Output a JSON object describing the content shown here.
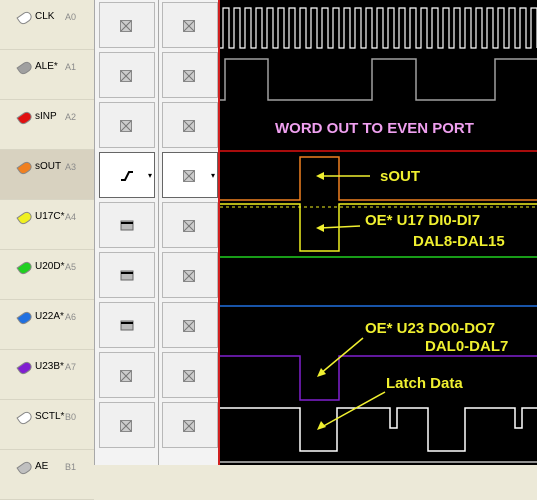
{
  "channels": [
    {
      "name": "CLK",
      "ch": "A0",
      "color": "#ffffff"
    },
    {
      "name": "ALE*",
      "ch": "A1",
      "color": "#a0a0a0"
    },
    {
      "name": "sINP",
      "ch": "A2",
      "color": "#e01010"
    },
    {
      "name": "sOUT",
      "ch": "A3",
      "color": "#f08020"
    },
    {
      "name": "U17C*",
      "ch": "A4",
      "color": "#f0f020"
    },
    {
      "name": "U20D*",
      "ch": "A5",
      "color": "#20d020"
    },
    {
      "name": "U22A*",
      "ch": "A6",
      "color": "#2070e0"
    },
    {
      "name": "U23B*",
      "ch": "A7",
      "color": "#8020d0"
    },
    {
      "name": "SCTL*",
      "ch": "B0",
      "color": "#ffffff"
    },
    {
      "name": "AE",
      "ch": "B1",
      "color": "#c0c0c0"
    }
  ],
  "trigger_col1": [
    "dontcare",
    "dontcare",
    "dontcare",
    "rising",
    "low",
    "low",
    "low",
    "dontcare",
    "dontcare"
  ],
  "trigger_col2": [
    "dontcare",
    "dontcare",
    "dontcare",
    "dontcare",
    "dontcare",
    "dontcare",
    "dontcare",
    "dontcare",
    "dontcare"
  ],
  "annotations": {
    "title": "WORD OUT TO EVEN PORT",
    "sout": "sOUT",
    "oe17_line1": "OE* U17 DI0-DI7",
    "oe17_line2": "DAL8-DAL15",
    "oe23_line1": "OE* U23 DO0-DO7",
    "oe23_line2": "DAL0-DAL7",
    "latch": "Latch Data"
  },
  "colors": {
    "annotation_yellow": "#f0f030",
    "title_pink": "#f0a0f0",
    "cursor": "#d02020"
  }
}
